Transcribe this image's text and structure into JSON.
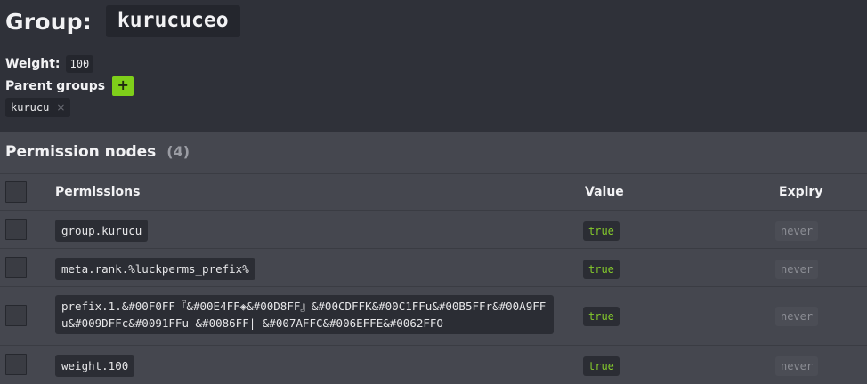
{
  "group": {
    "label": "Group:",
    "name": "kurucuceo"
  },
  "weight": {
    "label": "Weight:",
    "value": "100"
  },
  "parents": {
    "label": "Parent groups",
    "add_label": "+",
    "items": [
      {
        "name": "kurucu",
        "remove": "×"
      }
    ]
  },
  "permissions": {
    "title": "Permission nodes",
    "count": "(4)",
    "columns": {
      "permission": "Permissions",
      "value": "Value",
      "expiry": "Expiry"
    },
    "rows": [
      {
        "node": "group.kurucu",
        "value": "true",
        "expiry": "never"
      },
      {
        "node": "meta.rank.%luckperms_prefix%",
        "value": "true",
        "expiry": "never"
      },
      {
        "node": "prefix.1.&#00F0FF『&#00E4FF◈&#00D8FF』&#00CDFFK&#00C1FFu&#00B5FFr&#00A9FFu&#009DFFc&#0091FFu &#0086FF| &#007AFFC&#006EFFE&#0062FFO",
        "value": "true",
        "expiry": "never"
      },
      {
        "node": "weight.100",
        "value": "true",
        "expiry": "never"
      }
    ]
  },
  "colors": {
    "background": "#2f3139",
    "panel": "#45474f",
    "accent_green": "#7fcf1a",
    "true_text": "#84c92c"
  }
}
